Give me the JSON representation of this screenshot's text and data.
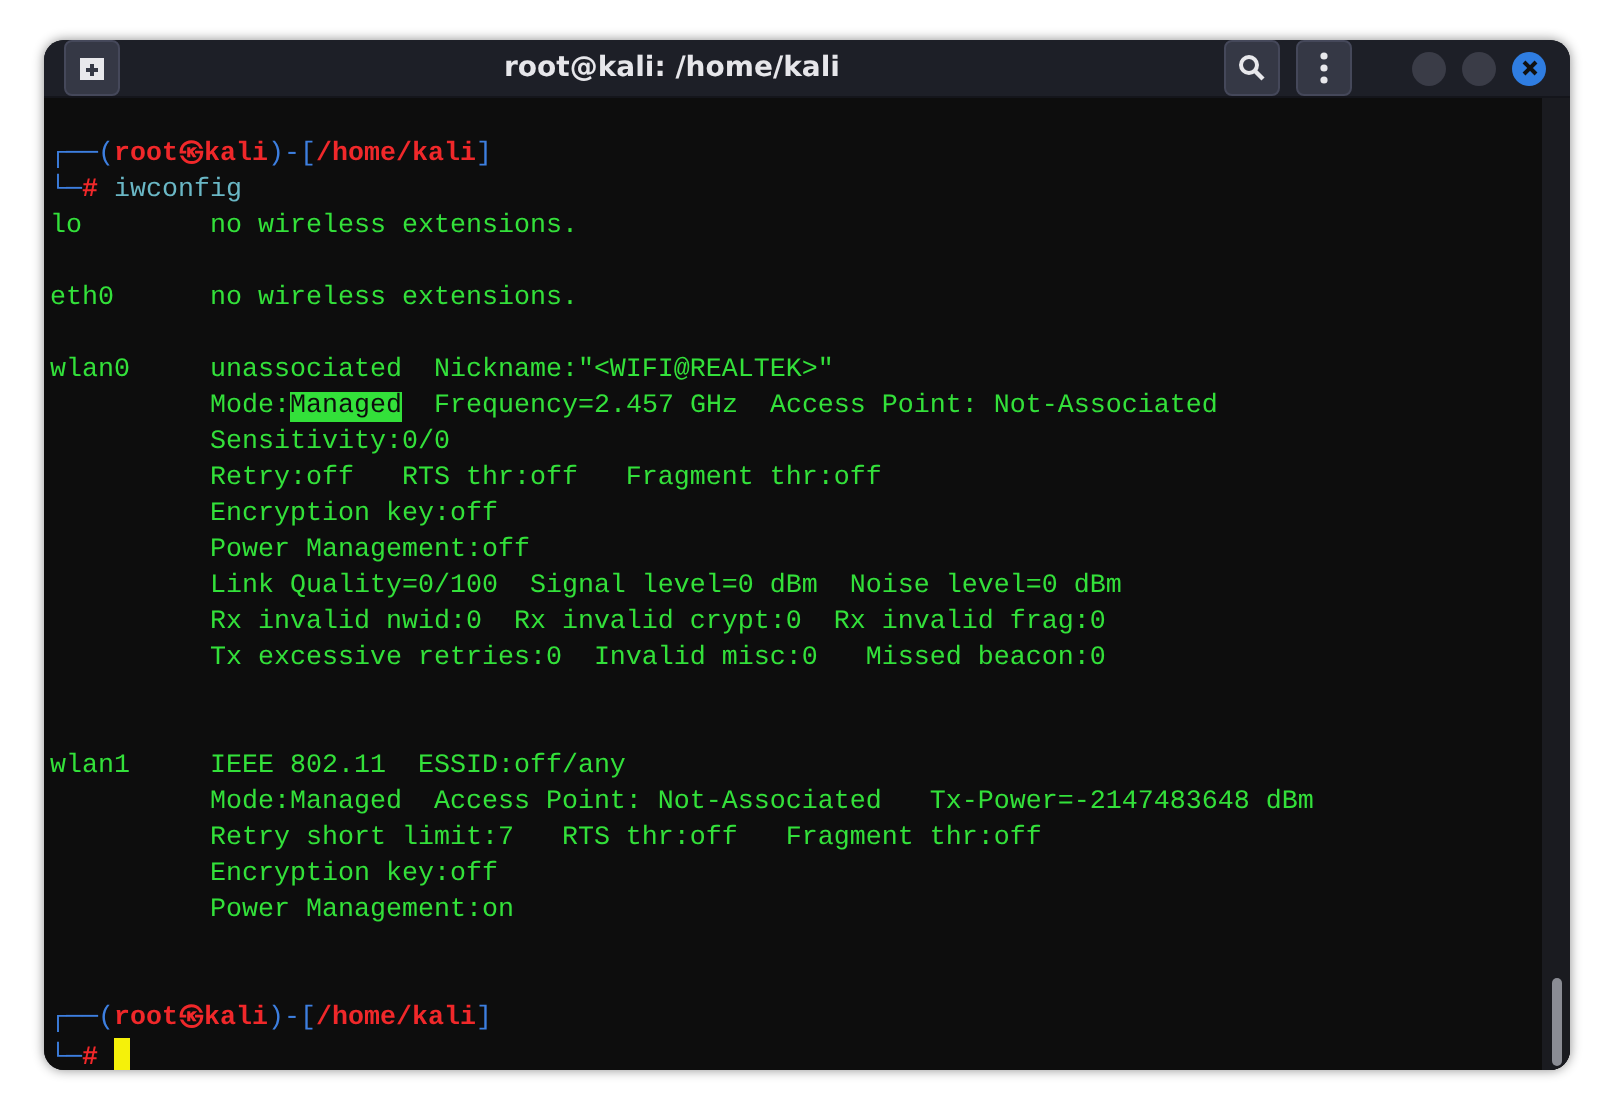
{
  "window": {
    "title": "root@kali: /home/kali"
  },
  "terminal": {
    "lines": [
      {
        "kind": "prompt",
        "top": "┌──(",
        "user": "root㉿kali",
        "sep": ")-[",
        "path": "/home/kali",
        "close": "]"
      },
      {
        "kind": "command",
        "corner": "└─",
        "symbol": "#",
        "text": "iwconfig",
        "cursor": false
      },
      {
        "kind": "output",
        "text": "lo        no wireless extensions."
      },
      {
        "kind": "blank"
      },
      {
        "kind": "output",
        "text": "eth0      no wireless extensions."
      },
      {
        "kind": "blank"
      },
      {
        "kind": "output",
        "text": "wlan0     unassociated  Nickname:\"<WIFI@REALTEK>\""
      },
      {
        "kind": "output",
        "parts": [
          {
            "text": "          Mode:",
            "highlighted": false
          },
          {
            "text": "Managed",
            "highlighted": true
          },
          {
            "text": "  Frequency=2.457 GHz  Access Point: Not-Associated",
            "highlighted": false
          }
        ]
      },
      {
        "kind": "output",
        "text": "          Sensitivity:0/0"
      },
      {
        "kind": "output",
        "text": "          Retry:off   RTS thr:off   Fragment thr:off"
      },
      {
        "kind": "output",
        "text": "          Encryption key:off"
      },
      {
        "kind": "output",
        "text": "          Power Management:off"
      },
      {
        "kind": "output",
        "text": "          Link Quality=0/100  Signal level=0 dBm  Noise level=0 dBm"
      },
      {
        "kind": "output",
        "text": "          Rx invalid nwid:0  Rx invalid crypt:0  Rx invalid frag:0"
      },
      {
        "kind": "output",
        "text": "          Tx excessive retries:0  Invalid misc:0   Missed beacon:0"
      },
      {
        "kind": "blank"
      },
      {
        "kind": "blank"
      },
      {
        "kind": "output",
        "text": "wlan1     IEEE 802.11  ESSID:off/any"
      },
      {
        "kind": "output",
        "text": "          Mode:Managed  Access Point: Not-Associated   Tx-Power=-2147483648 dBm"
      },
      {
        "kind": "output",
        "text": "          Retry short limit:7   RTS thr:off   Fragment thr:off"
      },
      {
        "kind": "output",
        "text": "          Encryption key:off"
      },
      {
        "kind": "output",
        "text": "          Power Management:on"
      },
      {
        "kind": "blank"
      },
      {
        "kind": "blank"
      },
      {
        "kind": "prompt",
        "top": "┌──(",
        "user": "root㉿kali",
        "sep": ")-[",
        "path": "/home/kali",
        "close": "]"
      },
      {
        "kind": "command",
        "corner": "└─",
        "symbol": "#",
        "cursor": true
      }
    ]
  }
}
